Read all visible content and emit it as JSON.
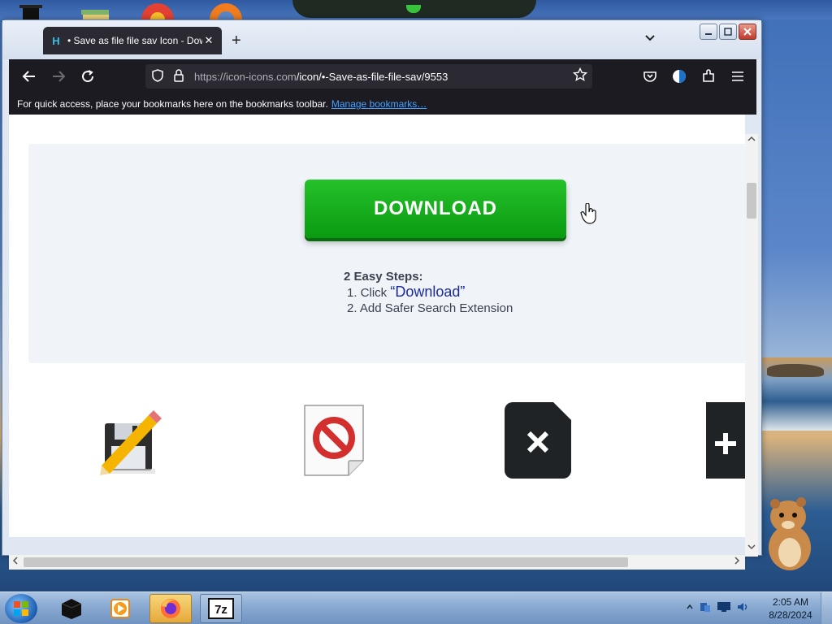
{
  "browser": {
    "tab_title": "• Save as file file sav Icon - Dow",
    "tab_close": "✕",
    "new_tab": "+",
    "tab_list": "⌄",
    "url_host": "https://icon-icons.com",
    "url_path": "/icon/•-Save-as-file-file-sav/9553",
    "bookmarks_message": "For quick access, place your bookmarks here on the bookmarks toolbar.",
    "manage_bookmarks": "Manage bookmarks…"
  },
  "page": {
    "download_button": "DOWNLOAD",
    "steps_heading": "2 Easy Steps:",
    "step1_prefix": "1. Click ",
    "step1_word": "“Download”",
    "step2": "2. Add Safer Search Extension",
    "icons": [
      "floppy-pencil-icon",
      "no-entry-file-icon",
      "close-file-icon",
      "plus-file-icon"
    ]
  },
  "taskbar": {
    "time": "2:05 AM",
    "date": "8/28/2024"
  },
  "colors": {
    "download_green": "#10a617",
    "browser_dark": "#1c1b22",
    "link_blue": "#45a1ff"
  }
}
